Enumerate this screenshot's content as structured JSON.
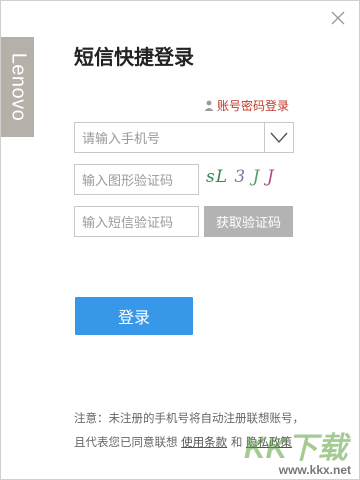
{
  "brand": {
    "logo_text": "Lenovo"
  },
  "title": "短信快捷登录",
  "account_link": "账号密码登录",
  "phone": {
    "placeholder": "请输入手机号"
  },
  "image_code": {
    "placeholder": "输入图形验证码",
    "captcha": [
      "sL",
      "3",
      "J",
      "J"
    ]
  },
  "sms_code": {
    "placeholder": "输入短信验证码",
    "get_code_label": "获取验证码"
  },
  "login_label": "登录",
  "notice": {
    "line1": "注意：未注册的手机号将自动注册联想账号，",
    "line2_prefix": "且代表您已同意联想",
    "terms": "使用条款",
    "and": "和",
    "privacy": "隐私政策"
  },
  "watermark": {
    "big": "KK下载",
    "url": "www.kkx.net"
  },
  "colors": {
    "accent": "#3797e8",
    "brand_tab": "#b5b0a8",
    "link_red": "#c0392b",
    "disabled": "#b3b3b3"
  }
}
